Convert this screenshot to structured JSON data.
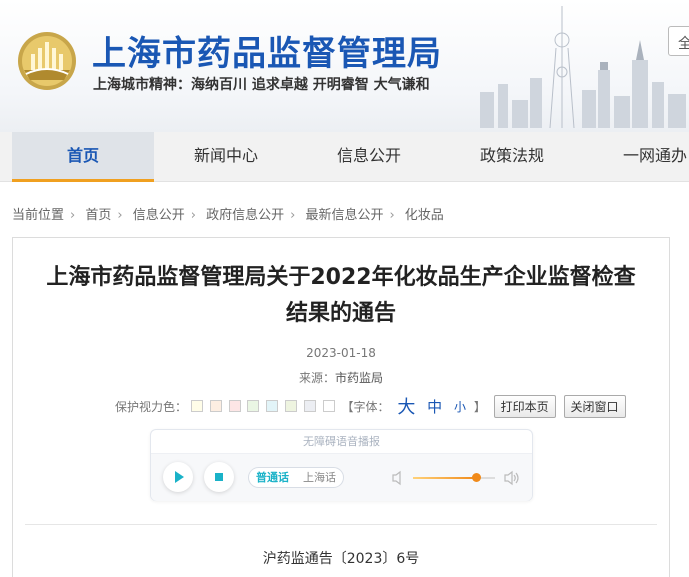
{
  "header": {
    "title": "上海市药品监督管理局",
    "motto": "上海城市精神：海纳百川  追求卓越  开明睿智  大气谦和",
    "top_button": "全"
  },
  "nav": {
    "items": [
      "首页",
      "新闻中心",
      "信息公开",
      "政策法规",
      "一网通办"
    ],
    "active_index": 0
  },
  "breadcrumb": {
    "label": "当前位置",
    "items": [
      "首页",
      "信息公开",
      "政府信息公开",
      "最新信息公开",
      "化妆品"
    ]
  },
  "article": {
    "title_line1": "上海市药品监督管理局关于2022年化妆品生产企业监督检查",
    "title_line2": "结果的通告",
    "date": "2023-01-18",
    "source_label": "来源：",
    "source_value": "市药监局",
    "doc_number": "沪药监通告〔2023〕6号"
  },
  "tools": {
    "eye_color_label": "保护视力色：",
    "eye_colors": [
      "#fffde8",
      "#fdeee2",
      "#fde6e6",
      "#eaf6e4",
      "#e2f4f8",
      "#eef4e0",
      "#eceef3",
      "#ffffff"
    ],
    "font_label": "【字体：",
    "font_large": "大",
    "font_medium": "中",
    "font_small": "小",
    "font_close": "】",
    "print_label": "打印本页",
    "close_label": "关闭窗口"
  },
  "player": {
    "title": "无障碍语音播报",
    "languages": [
      "普通话",
      "上海话"
    ],
    "active_language": 0,
    "volume": 0.78
  },
  "colors": {
    "brand_blue": "#1a57b4",
    "nav_active_underline": "#f0a020",
    "player_accent": "#1ab2c8",
    "volume_accent": "#f08a1a"
  }
}
